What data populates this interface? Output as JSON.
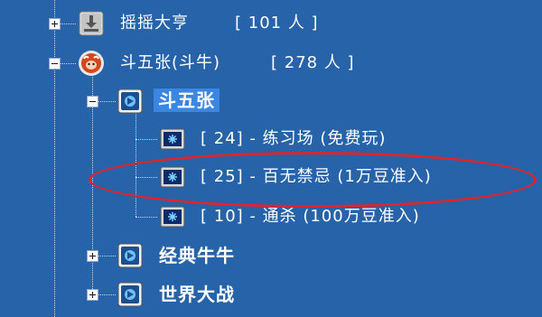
{
  "tree": {
    "games": [
      {
        "name": "摇摇大亨",
        "count": "[ 101 人 ]",
        "icon": "download-icon",
        "expanded": false
      },
      {
        "name": "斗五张(斗牛)",
        "count": "[ 278 人 ]",
        "icon": "bull-icon",
        "expanded": true
      }
    ],
    "categories": [
      {
        "label": "斗五张",
        "selected": true,
        "expanded": true
      },
      {
        "label": "经典牛牛",
        "selected": false,
        "expanded": false
      },
      {
        "label": "世界大战",
        "selected": false,
        "expanded": false
      }
    ],
    "rooms": [
      {
        "label": "[ 24] - 练习场 (免费玩)",
        "highlighted": false
      },
      {
        "label": "[ 25] - 百无禁忌 (1万豆准入)",
        "highlighted": true
      },
      {
        "label": "[ 10] - 通杀 (100万豆准入)",
        "highlighted": false
      }
    ]
  },
  "colors": {
    "background": "#2663a9",
    "selection": "#3b86e0",
    "annotation": "#e0242b",
    "text": "#ffffff"
  }
}
